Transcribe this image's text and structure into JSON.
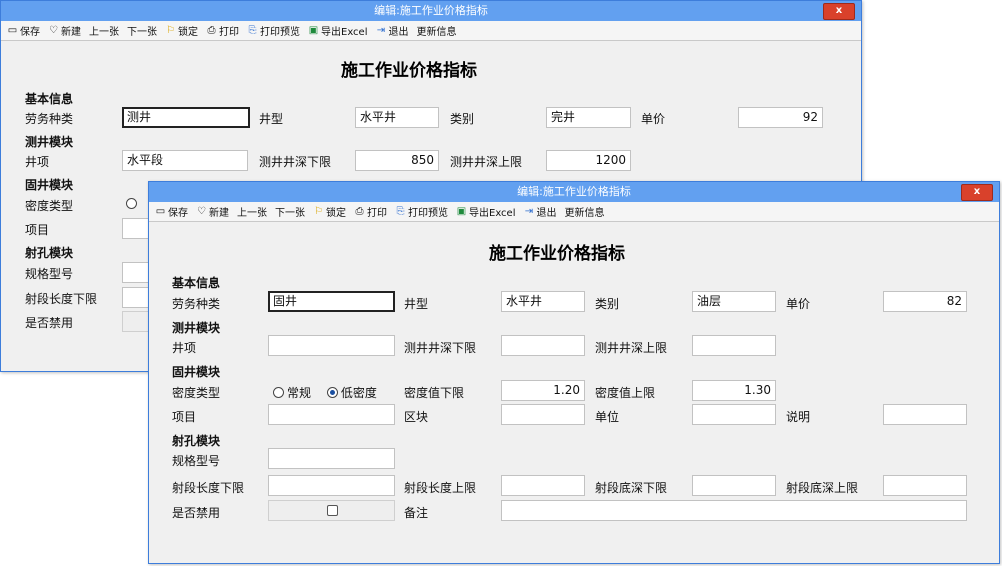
{
  "back": {
    "title": "编辑:施工作业价格指标",
    "close": "x",
    "toolbar": [
      {
        "icon": "▭",
        "label": "保存"
      },
      {
        "icon": "♡",
        "label": "新建"
      },
      {
        "icon": "",
        "label": "上一张"
      },
      {
        "icon": "",
        "label": "下一张"
      },
      {
        "icon": "⚐",
        "label": "锁定"
      },
      {
        "icon": "⎙",
        "label": "打印"
      },
      {
        "icon": "⎘",
        "label": "打印预览"
      },
      {
        "icon": "▣",
        "label": "导出Excel"
      },
      {
        "icon": "⇥",
        "label": "退出"
      },
      {
        "icon": "",
        "label": "更新信息"
      }
    ],
    "form_title": "施工作业价格指标",
    "sections": {
      "basic": "基本信息",
      "measure": "测井模块",
      "fix": "固井模块",
      "perf": "射孔模块"
    },
    "labels": {
      "labor_type": "劳务种类",
      "well_type": "井型",
      "category": "类别",
      "unit_price": "单价",
      "well_item": "井项",
      "depth_low": "测井井深下限",
      "depth_high": "测井井深上限",
      "density_type": "密度类型",
      "item": "项目",
      "spec": "规格型号",
      "seg_len_low": "射段长度下限",
      "disabled": "是否禁用"
    },
    "values": {
      "labor_type": "测井",
      "well_type": "水平井",
      "category": "完井",
      "unit_price": "92",
      "well_item": "水平段",
      "depth_low": "850",
      "depth_high": "1200"
    }
  },
  "front": {
    "title": "编辑:施工作业价格指标",
    "close": "x",
    "toolbar": [
      {
        "icon": "▭",
        "label": "保存"
      },
      {
        "icon": "♡",
        "label": "新建"
      },
      {
        "icon": "",
        "label": "上一张"
      },
      {
        "icon": "",
        "label": "下一张"
      },
      {
        "icon": "⚐",
        "label": "锁定"
      },
      {
        "icon": "⎙",
        "label": "打印"
      },
      {
        "icon": "⎘",
        "label": "打印预览"
      },
      {
        "icon": "▣",
        "label": "导出Excel"
      },
      {
        "icon": "⇥",
        "label": "退出"
      },
      {
        "icon": "",
        "label": "更新信息"
      }
    ],
    "form_title": "施工作业价格指标",
    "sections": {
      "basic": "基本信息",
      "measure": "测井模块",
      "fix": "固井模块",
      "perf": "射孔模块"
    },
    "labels": {
      "labor_type": "劳务种类",
      "well_type": "井型",
      "category": "类别",
      "unit_price": "单价",
      "well_item": "井项",
      "depth_low": "测井井深下限",
      "depth_high": "测井井深上限",
      "density_type": "密度类型",
      "density_low": "密度值下限",
      "density_high": "密度值上限",
      "item": "项目",
      "block": "区块",
      "unit": "单位",
      "note": "说明",
      "spec": "规格型号",
      "seg_len_low": "射段长度下限",
      "seg_len_high": "射段长度上限",
      "seg_bottom_low": "射段底深下限",
      "seg_bottom_high": "射段底深上限",
      "disabled": "是否禁用",
      "remark": "备注"
    },
    "density_options": [
      "常规",
      "低密度"
    ],
    "density_selected": "低密度",
    "values": {
      "labor_type": "固井",
      "well_type": "水平井",
      "category": "油层",
      "unit_price": "82",
      "well_item": "",
      "depth_low": "",
      "depth_high": "",
      "density_low": "1.20",
      "density_high": "1.30",
      "item": "",
      "block": "",
      "unit": "",
      "note": "",
      "spec": "",
      "seg_len_low": "",
      "seg_len_high": "",
      "seg_bottom_low": "",
      "seg_bottom_high": "",
      "remark": ""
    },
    "disabled_checked": false
  }
}
